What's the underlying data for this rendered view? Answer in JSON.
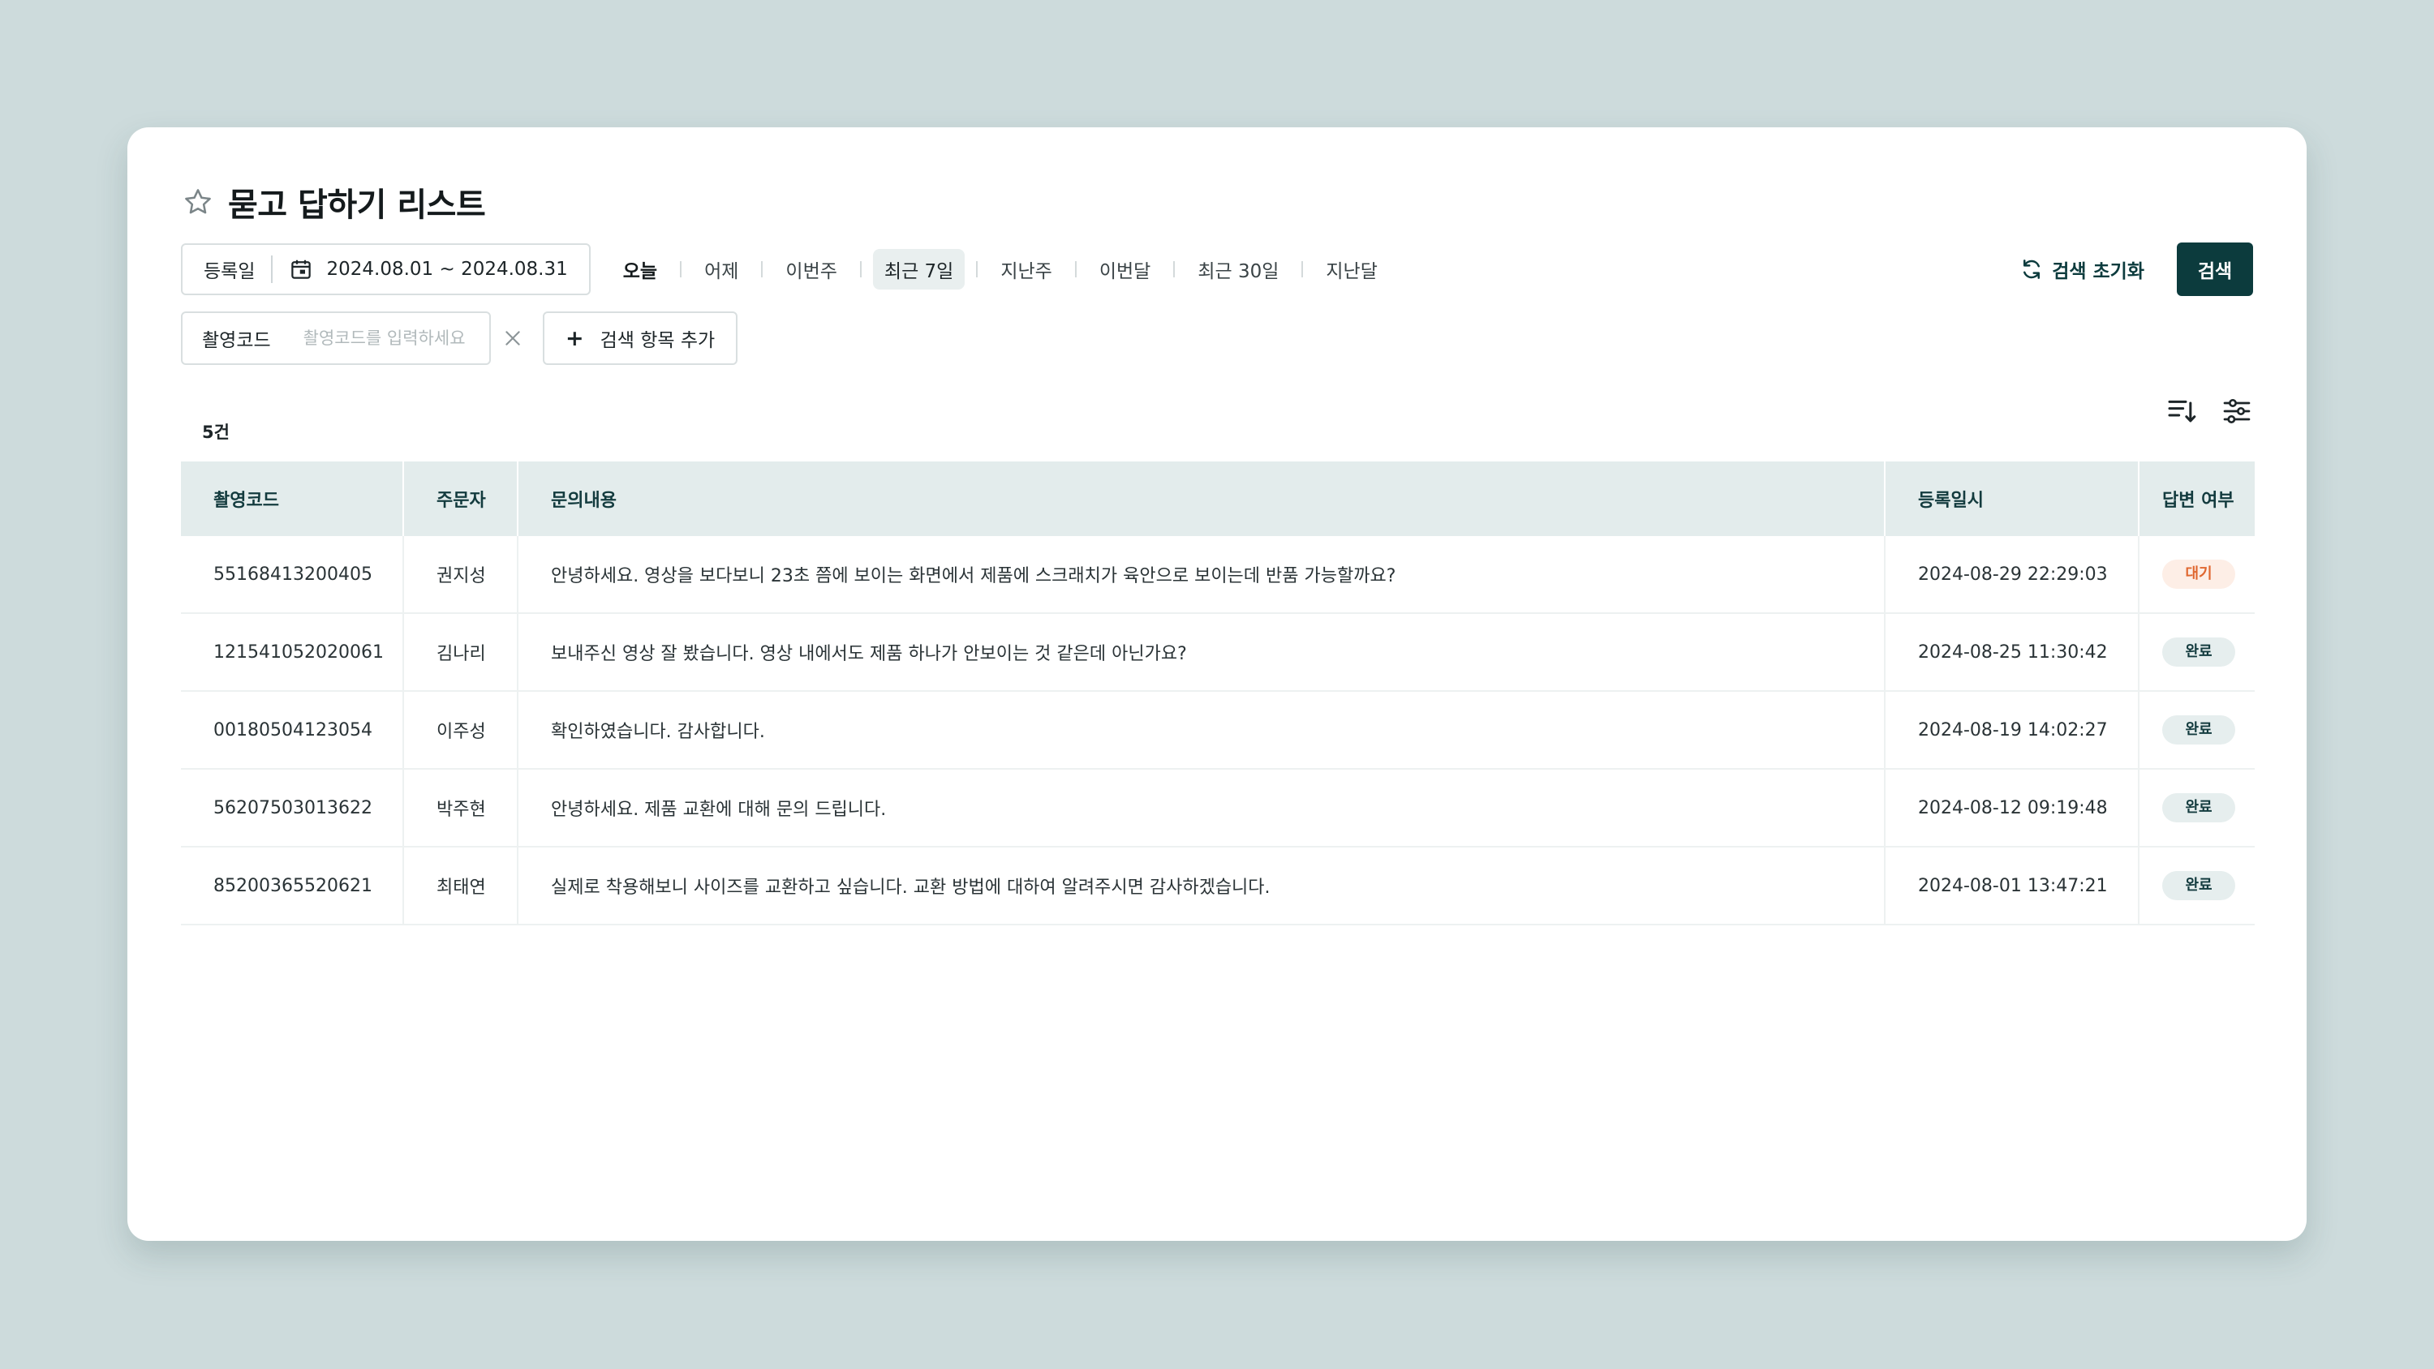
{
  "page": {
    "title": "묻고 답하기 리스트",
    "title_icon": "star-icon"
  },
  "filters": {
    "date_label": "등록일",
    "date_range": "2024.08.01 ~ 2024.08.31",
    "quick_ranges": [
      "오늘",
      "어제",
      "이번주",
      "최근 7일",
      "지난주",
      "이번달",
      "최근 30일",
      "지난달"
    ],
    "active_quick_range": "최근 7일",
    "reset_label": "검색 초기화",
    "search_label": "검색",
    "code_label": "촬영코드",
    "code_value": "",
    "code_placeholder": "촬영코드를 입력하세요",
    "add_label": "검색 항목 추가"
  },
  "list": {
    "count_label": "5건",
    "tool_icons": [
      "sort-icon",
      "filter-settings-icon"
    ]
  },
  "table": {
    "headers": [
      "촬영코드",
      "주문자",
      "문의내용",
      "등록일시",
      "답변 여부"
    ],
    "rows": [
      {
        "code": "55168413200405",
        "customer": "권지성",
        "content": "안녕하세요. 영상을 보다보니 23초 쯤에 보이는 화면에서 제품에 스크래치가 육안으로 보이는데 반품 가능할까요?",
        "date": "2024-08-29 22:29:03",
        "status": "대기"
      },
      {
        "code": "121541052020061",
        "customer": "김나리",
        "content": "보내주신 영상 잘 봤습니다. 영상 내에서도 제품 하나가 안보이는 것 같은데 아닌가요?",
        "date": "2024-08-25 11:30:42",
        "status": "완료"
      },
      {
        "code": "00180504123054",
        "customer": "이주성",
        "content": "확인하였습니다. 감사합니다.",
        "date": "2024-08-19 14:02:27",
        "status": "완료"
      },
      {
        "code": "56207503013622",
        "customer": "박주현",
        "content": "안녕하세요. 제품 교환에 대해 문의 드립니다.",
        "date": "2024-08-12 09:19:48",
        "status": "완료"
      },
      {
        "code": "85200365520621",
        "customer": "최태연",
        "content": "실제로 착용해보니 사이즈를 교환하고 싶습니다. 교환 방법에 대하여 알려주시면 감사하겠습니다.",
        "date": "2024-08-01 13:47:21",
        "status": "완료"
      }
    ]
  },
  "colors": {
    "background": "#cddbdc",
    "primary": "#0c3b3d",
    "header_bg": "#e3ecec",
    "wait_badge": "#e0672f",
    "done_badge": "#133b3e"
  }
}
